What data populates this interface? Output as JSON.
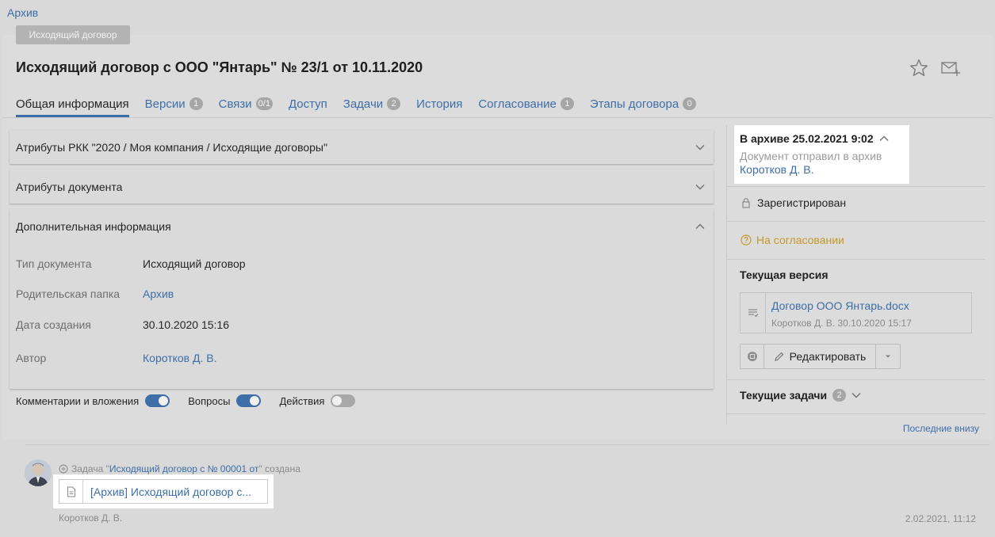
{
  "breadcrumb": "Архив",
  "doc": {
    "type_badge": "Исходящий договор",
    "title": "Исходящий договор с ООО \"Янтарь\" № 23/1 от 10.11.2020"
  },
  "tabs": [
    {
      "label": "Общая информация",
      "count": ""
    },
    {
      "label": "Версии",
      "count": "1"
    },
    {
      "label": "Связи",
      "count": "0/1"
    },
    {
      "label": "Доступ",
      "count": ""
    },
    {
      "label": "Задачи",
      "count": "2"
    },
    {
      "label": "История",
      "count": ""
    },
    {
      "label": "Согласование",
      "count": "1"
    },
    {
      "label": "Этапы договора",
      "count": "0"
    }
  ],
  "sections": {
    "rkk": "Атрибуты РКК \"2020 / Моя компания / Исходящие договоры\"",
    "doc_attrs": "Атрибуты документа",
    "extra": "Дополнительная информация"
  },
  "extra_info": {
    "type_key": "Тип документа",
    "type_val": "Исходящий договор",
    "folder_key": "Родительская папка",
    "folder_val": "Архив",
    "date_key": "Дата создания",
    "date_val": "30.10.2020 15:16",
    "author_key": "Автор",
    "author_val": "Коротков Д. В."
  },
  "toggles": {
    "comments": "Комментарии и вложения",
    "questions": "Вопросы",
    "actions": "Действия",
    "comments_on": true,
    "questions_on": true,
    "actions_on": false
  },
  "archive": {
    "title": "В архиве 25.02.2021 9:02",
    "text": "Документ отправил в архив",
    "author": "Коротков Д. В."
  },
  "status": {
    "registered": "Зарегистрирован",
    "approval": "На согласовании"
  },
  "current_version": {
    "heading": "Текущая версия",
    "file_name": "Договор ООО Янтарь.docx",
    "meta": "Коротков Д. В. 30.10.2020 15:17",
    "edit_label": "Редактировать"
  },
  "current_tasks": {
    "heading": "Текущие задачи",
    "count": "2"
  },
  "feed": {
    "order_link": "Последние внизу",
    "event_prefix": "Задача \"",
    "event_link": "Исходящий договор с № 00001 от ",
    "event_suffix": "\" создана",
    "card_text": "[Архив] Исходящий договор с...",
    "author": "Коротков Д. В.",
    "time": "2.02.2021, 11:12"
  },
  "colors": {
    "accent": "#3d6ea8",
    "warning": "#c49a2a",
    "background": "#d9d9d9"
  }
}
